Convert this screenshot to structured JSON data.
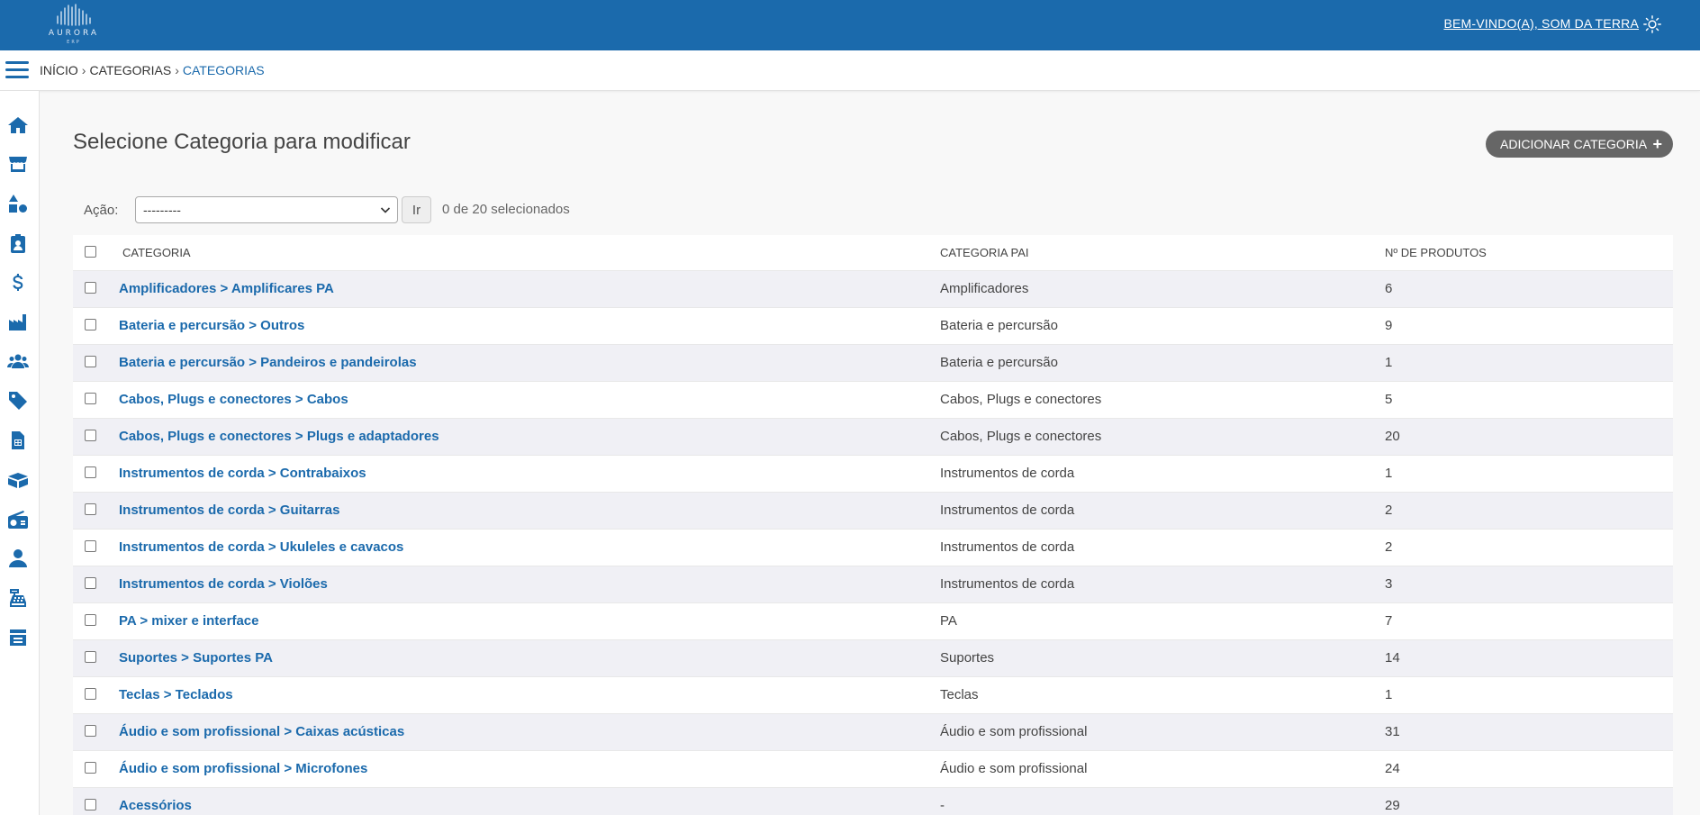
{
  "header": {
    "logo_text": "AURORA",
    "logo_sub": "ERP",
    "welcome_prefix": "BEM-VINDO(A),",
    "welcome_user": "SOM DA TERRA"
  },
  "breadcrumb": {
    "items": [
      "INÍCIO",
      "CATEGORIAS",
      "CATEGORIAS"
    ],
    "separator": "›"
  },
  "sidebar": {
    "icons": [
      "home-icon",
      "store-icon",
      "shapes-icon",
      "clipboard-user-icon",
      "dollar-icon",
      "industry-icon",
      "users-icon",
      "tag-icon",
      "invoice-icon",
      "boxes-icon",
      "radio-icon",
      "user-icon",
      "cash-register-icon",
      "inbox-list-icon"
    ]
  },
  "main": {
    "title": "Selecione Categoria para modificar",
    "add_button": "ADICIONAR CATEGORIA",
    "action_label": "Ação:",
    "action_select_value": "---------",
    "go_button": "Ir",
    "selected_count": "0 de 20 selecionados"
  },
  "table": {
    "headers": [
      "CATEGORIA",
      "CATEGORIA PAI",
      "Nº DE PRODUTOS"
    ],
    "rows": [
      {
        "category": "Amplificadores > Amplificares PA",
        "parent": "Amplificadores",
        "count": "6"
      },
      {
        "category": "Bateria e percursão > Outros",
        "parent": "Bateria e percursão",
        "count": "9"
      },
      {
        "category": "Bateria e percursão > Pandeiros e pandeirolas",
        "parent": "Bateria e percursão",
        "count": "1"
      },
      {
        "category": "Cabos, Plugs e conectores > Cabos",
        "parent": "Cabos, Plugs e conectores",
        "count": "5"
      },
      {
        "category": "Cabos, Plugs e conectores > Plugs e adaptadores",
        "parent": "Cabos, Plugs e conectores",
        "count": "20"
      },
      {
        "category": "Instrumentos de corda > Contrabaixos",
        "parent": "Instrumentos de corda",
        "count": "1"
      },
      {
        "category": "Instrumentos de corda > Guitarras",
        "parent": "Instrumentos de corda",
        "count": "2"
      },
      {
        "category": "Instrumentos de corda > Ukuleles e cavacos",
        "parent": "Instrumentos de corda",
        "count": "2"
      },
      {
        "category": "Instrumentos de corda > Violões",
        "parent": "Instrumentos de corda",
        "count": "3"
      },
      {
        "category": "PA > mixer e interface",
        "parent": "PA",
        "count": "7"
      },
      {
        "category": "Suportes > Suportes PA",
        "parent": "Suportes",
        "count": "14"
      },
      {
        "category": "Teclas > Teclados",
        "parent": "Teclas",
        "count": "1"
      },
      {
        "category": "Áudio e som profissional > Caixas acústicas",
        "parent": "Áudio e som profissional",
        "count": "31"
      },
      {
        "category": "Áudio e som profissional > Microfones",
        "parent": "Áudio e som profissional",
        "count": "24"
      },
      {
        "category": "Acessórios",
        "parent": "-",
        "count": "29"
      }
    ]
  },
  "colors": {
    "brand": "#1b6aac",
    "add_button_bg": "#666666",
    "row_stripe": "#f0f0f5"
  }
}
